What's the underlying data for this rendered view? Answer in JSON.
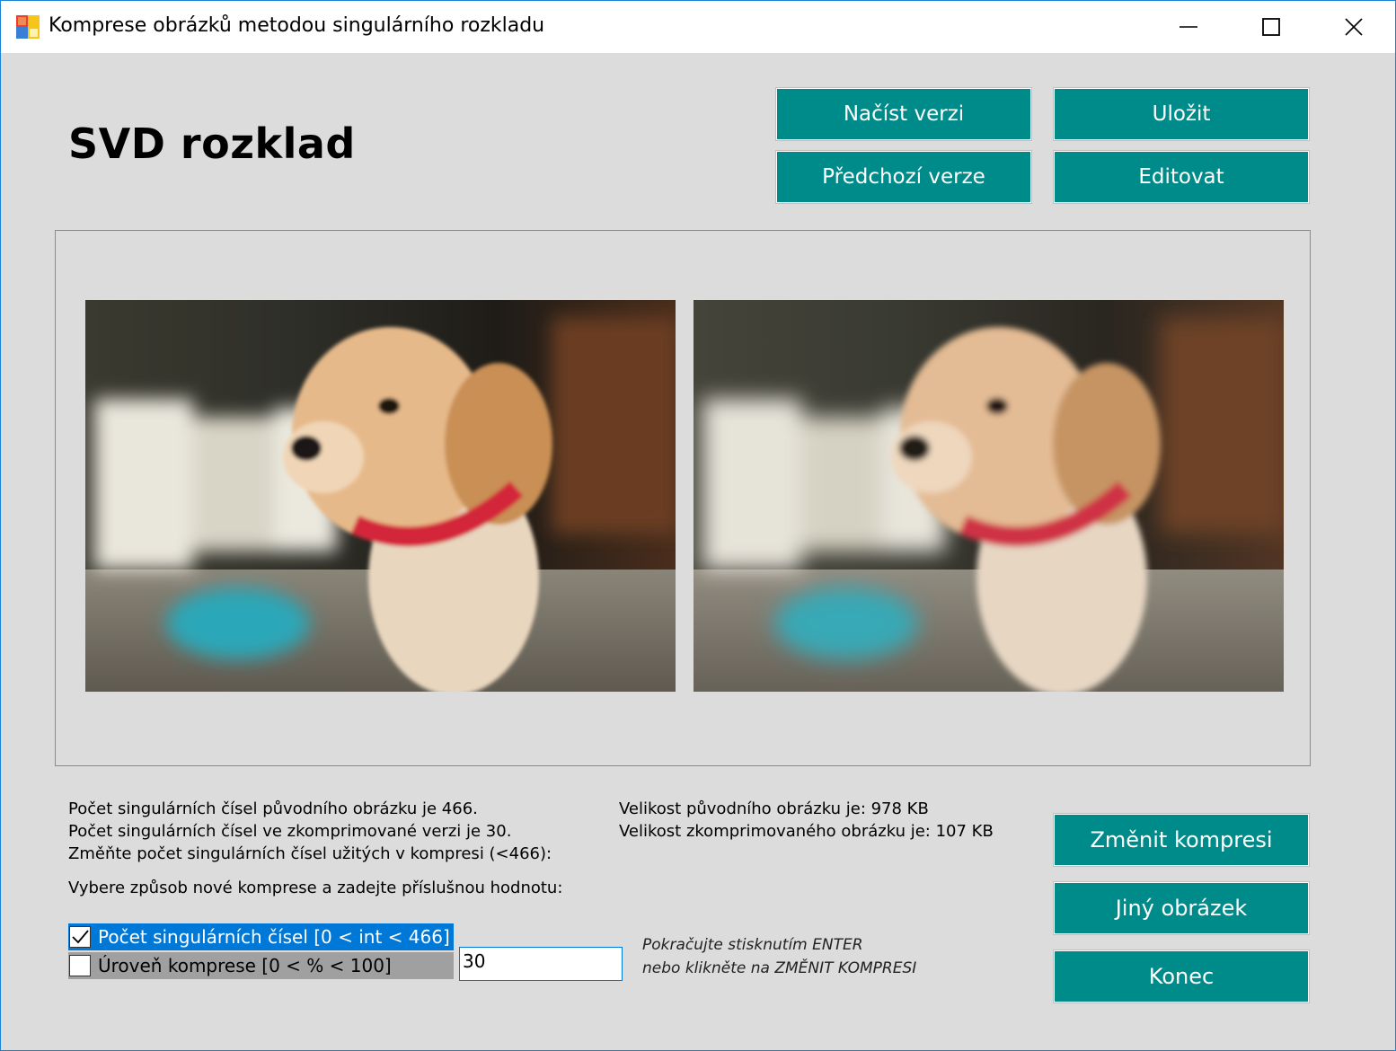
{
  "window": {
    "title": "Komprese obrázků metodou singulárního rozkladu"
  },
  "header": {
    "heading": "SVD rozklad"
  },
  "toolbar": {
    "load_version": "Načíst verzi",
    "save": "Uložit",
    "previous_version": "Předchozí verze",
    "edit": "Editovat"
  },
  "info": {
    "line1": "Počet singulárních čísel původního obrázku je 466.",
    "line2": "Počet singulárních čísel ve zkomprimované verzi je 30.",
    "line3": "Změňte počet singulárních čísel užitých v kompresi (<466):",
    "line4": "Vybere způsob nové komprese a zadejte příslušnou hodnotu:",
    "size_original": "Velikost původního obrázku je: 978 KB",
    "size_compressed": "Velikost zkomprimovaného obrázku je: 107 KB"
  },
  "options": [
    {
      "label": "Počet singulárních čísel [0 < int < 466]",
      "checked": true
    },
    {
      "label": "Úroveň komprese [0 < % < 100]",
      "checked": false
    }
  ],
  "input": {
    "value": "30"
  },
  "hint": {
    "line1": "Pokračujte stisknutím ENTER",
    "line2": "nebo klikněte na ZMĚNIT KOMPRESI"
  },
  "actions": {
    "change_compression": "Změnit kompresi",
    "other_image": "Jiný obrázek",
    "quit": "Konec"
  },
  "colors": {
    "button": "#008b8b",
    "selection": "#0078d7",
    "window_bg": "#dcdcdc"
  }
}
